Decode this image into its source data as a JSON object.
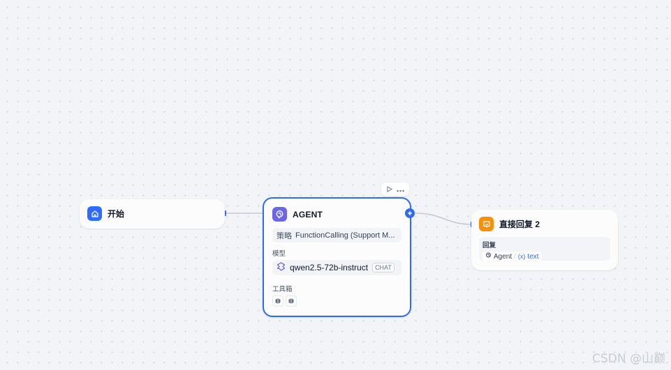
{
  "nodes": {
    "start": {
      "title": "开始",
      "icon": "home-icon"
    },
    "agent": {
      "title": "AGENT",
      "icon": "agent-icon",
      "strategy_label": "策略",
      "strategy_value": "FunctionCalling (Support M...",
      "model_section_label": "模型",
      "model_name": "qwen2.5-72b-instruct",
      "model_badge": "CHAT",
      "toolbox_label": "工具箱",
      "tools": [
        "tool-icon",
        "tool-icon"
      ]
    },
    "reply": {
      "title": "直接回复 2",
      "icon": "reply-icon",
      "reply_label": "回复",
      "variable": {
        "node": "Agent",
        "separator": "/",
        "prefix": "(x)",
        "name": "text"
      }
    }
  },
  "colors": {
    "accent": "#2e6bf2",
    "start_icon_bg": "#2f6bff",
    "agent_icon_bg": "#6b66e8",
    "reply_icon_bg": "#f79009",
    "canvas_bg": "#f2f4f7"
  },
  "watermark": "CSDN @山巅"
}
